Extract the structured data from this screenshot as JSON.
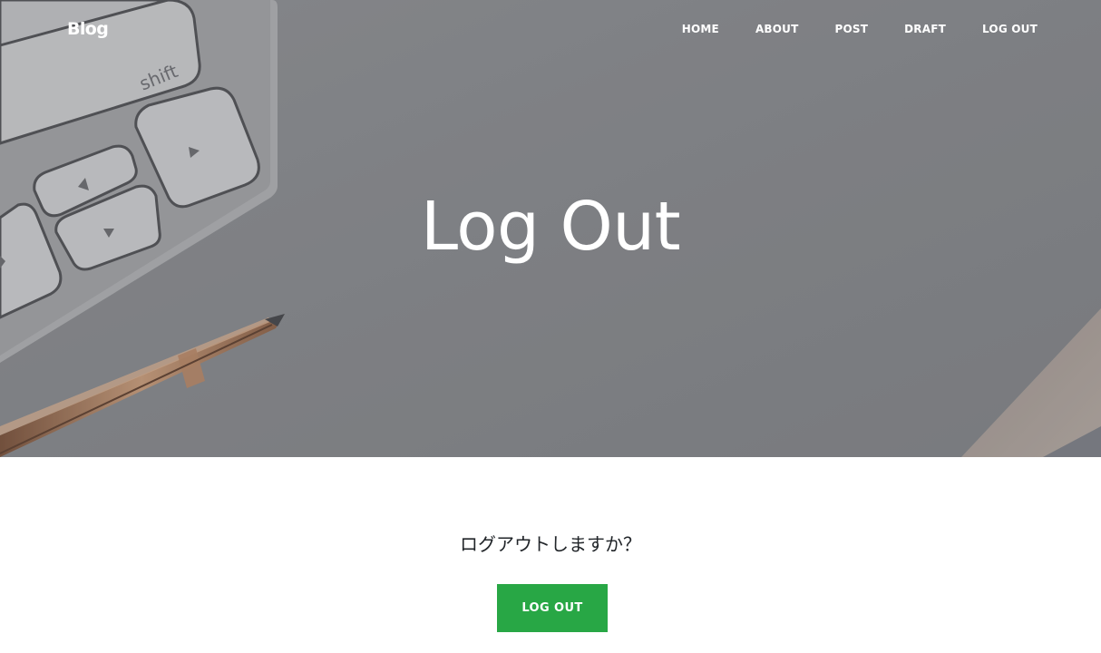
{
  "navbar": {
    "brand": "Blog",
    "items": [
      "HOME",
      "ABOUT",
      "POST",
      "DRAFT",
      "LOG OUT"
    ]
  },
  "hero": {
    "heading": "Log Out",
    "key_label": "shift"
  },
  "main": {
    "confirm_text": "ログアウトしますか？",
    "logout_button_label": "LOG OUT"
  },
  "colors": {
    "hero_overlay": "#8a8b8f",
    "button": "#28a745",
    "text": "#212529"
  }
}
